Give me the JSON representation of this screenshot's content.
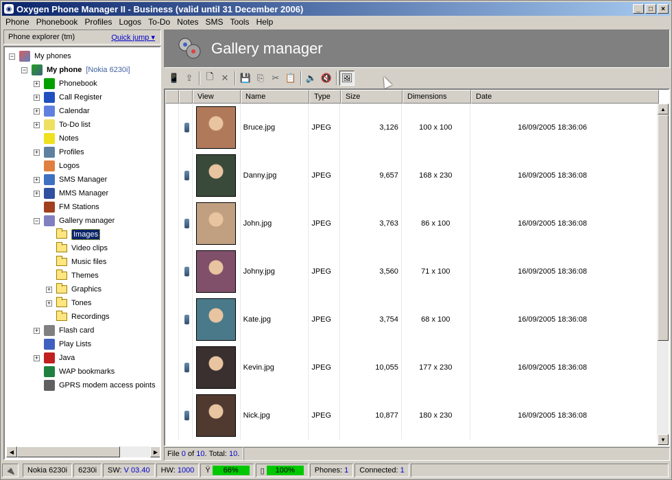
{
  "window": {
    "title": "Oxygen Phone Manager II - Business (valid until 31 December 2006)",
    "controls": [
      "_",
      "□",
      "×"
    ]
  },
  "menu": [
    "Phone",
    "Phonebook",
    "Profiles",
    "Logos",
    "To-Do",
    "Notes",
    "SMS",
    "Tools",
    "Help"
  ],
  "left": {
    "header": "Phone explorer (tm)",
    "quick_jump": "Quick jump",
    "root": "My phones",
    "phone_name": "My phone",
    "phone_model": "[Nokia 6230i]",
    "items": [
      {
        "label": "Phonebook",
        "icon": "phonebook-icon",
        "color": "#00a000",
        "exp": "+"
      },
      {
        "label": "Call Register",
        "icon": "call-register-icon",
        "color": "#2050c0",
        "exp": "+"
      },
      {
        "label": "Calendar",
        "icon": "calendar-icon",
        "color": "#6080e0",
        "exp": "+"
      },
      {
        "label": "To-Do list",
        "icon": "todo-icon",
        "color": "#f0e060",
        "exp": "+"
      },
      {
        "label": "Notes",
        "icon": "notes-icon",
        "color": "#f0e020",
        "exp": ""
      },
      {
        "label": "Profiles",
        "icon": "profiles-icon",
        "color": "#6080a0",
        "exp": "+"
      },
      {
        "label": "Logos",
        "icon": "logos-icon",
        "color": "#e08040",
        "exp": ""
      },
      {
        "label": "SMS Manager",
        "icon": "sms-icon",
        "color": "#4070c0",
        "exp": "+"
      },
      {
        "label": "MMS Manager",
        "icon": "mms-icon",
        "color": "#3050a0",
        "exp": "+"
      },
      {
        "label": "FM Stations",
        "icon": "radio-icon",
        "color": "#a04020",
        "exp": ""
      },
      {
        "label": "Gallery manager",
        "icon": "gallery-icon",
        "color": "#8080c0",
        "exp": "-"
      }
    ],
    "gallery_children": [
      {
        "label": "Images",
        "exp": "",
        "selected": true
      },
      {
        "label": "Video clips",
        "exp": ""
      },
      {
        "label": "Music files",
        "exp": ""
      },
      {
        "label": "Themes",
        "exp": ""
      },
      {
        "label": "Graphics",
        "exp": "+"
      },
      {
        "label": "Tones",
        "exp": "+"
      },
      {
        "label": "Recordings",
        "exp": ""
      }
    ],
    "after_items": [
      {
        "label": "Flash card",
        "icon": "flash-card-icon",
        "color": "#808080",
        "exp": "+"
      },
      {
        "label": "Play Lists",
        "icon": "playlist-icon",
        "color": "#4060c0",
        "exp": ""
      },
      {
        "label": "Java",
        "icon": "java-icon",
        "color": "#c02020",
        "exp": "+"
      },
      {
        "label": "WAP bookmarks",
        "icon": "wap-icon",
        "color": "#208040",
        "exp": ""
      },
      {
        "label": "GPRS modem access points",
        "icon": "gprs-icon",
        "color": "#606060",
        "exp": ""
      }
    ]
  },
  "right": {
    "banner_title": "Gallery manager",
    "columns": [
      "",
      "",
      "View",
      "Name",
      "Type",
      "Size",
      "Dimensions",
      "Date"
    ],
    "rows": [
      {
        "name": "Bruce.jpg",
        "type": "JPEG",
        "size": "3,126",
        "dimensions": "100 x 100",
        "date": "16/09/2005 18:36:06",
        "thumb_color": "#b07a5a"
      },
      {
        "name": "Danny.jpg",
        "type": "JPEG",
        "size": "9,657",
        "dimensions": "168 x 230",
        "date": "16/09/2005 18:36:08",
        "thumb_color": "#3a4a3a"
      },
      {
        "name": "John.jpg",
        "type": "JPEG",
        "size": "3,763",
        "dimensions": "86 x 100",
        "date": "16/09/2005 18:36:08",
        "thumb_color": "#c0a080"
      },
      {
        "name": "Johny.jpg",
        "type": "JPEG",
        "size": "3,560",
        "dimensions": "71 x 100",
        "date": "16/09/2005 18:36:08",
        "thumb_color": "#80506a"
      },
      {
        "name": "Kate.jpg",
        "type": "JPEG",
        "size": "3,754",
        "dimensions": "68 x 100",
        "date": "16/09/2005 18:36:08",
        "thumb_color": "#4a7a8a"
      },
      {
        "name": "Kevin.jpg",
        "type": "JPEG",
        "size": "10,055",
        "dimensions": "177 x 230",
        "date": "16/09/2005 18:36:08",
        "thumb_color": "#3a3030"
      },
      {
        "name": "Nick.jpg",
        "type": "JPEG",
        "size": "10,877",
        "dimensions": "180 x 230",
        "date": "16/09/2005 18:36:08",
        "thumb_color": "#503a30"
      }
    ],
    "footer": {
      "file_prefix": "File",
      "file_index": "0",
      "file_of": "of",
      "file_total_count": "10",
      "total_label": "Total:",
      "total_value": "10"
    }
  },
  "status": {
    "model": "Nokia 6230i",
    "short_model": "6230i",
    "sw_label": "SW:",
    "sw_value": "V 03.40",
    "hw_label": "HW:",
    "hw_value": "1000",
    "signal": "66%",
    "signal_level": 0.66,
    "battery": "100%",
    "battery_level": 1.0,
    "phones_label": "Phones:",
    "phones_value": "1",
    "connected_label": "Connected:",
    "connected_value": "1"
  }
}
